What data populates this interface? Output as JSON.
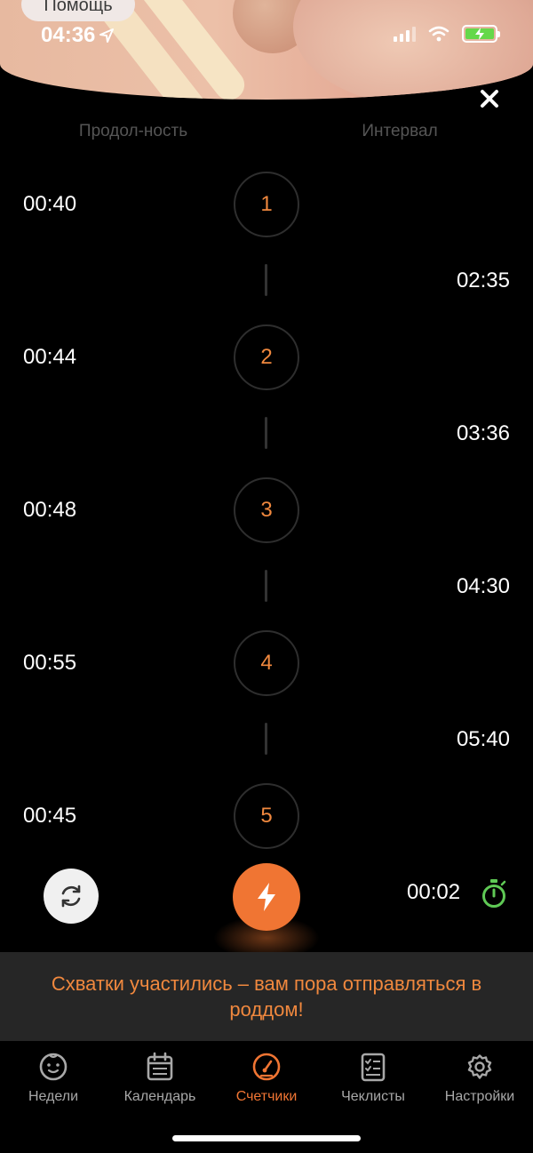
{
  "status_bar": {
    "help_label": "Помощь",
    "time": "04:36"
  },
  "header": {
    "col_duration": "Продол-ность",
    "col_interval": "Интервал"
  },
  "contractions": [
    {
      "number": "1",
      "duration": "00:40"
    },
    {
      "number": "2",
      "duration": "00:44"
    },
    {
      "number": "3",
      "duration": "00:48"
    },
    {
      "number": "4",
      "duration": "00:55"
    },
    {
      "number": "5",
      "duration": "00:45"
    }
  ],
  "intervals": [
    "02:35",
    "03:36",
    "04:30",
    "05:40"
  ],
  "controls": {
    "timer": "00:02"
  },
  "alert": {
    "message": "Схватки участились – вам пора отправляться в роддом!"
  },
  "tabbar": {
    "items": [
      {
        "label": "Недели",
        "icon": "baby-face-icon"
      },
      {
        "label": "Календарь",
        "icon": "calendar-icon"
      },
      {
        "label": "Счетчики",
        "icon": "gauge-icon",
        "active": true
      },
      {
        "label": "Чеклисты",
        "icon": "checklist-icon"
      },
      {
        "label": "Настройки",
        "icon": "gear-icon"
      }
    ]
  },
  "colors": {
    "accent": "#f07533",
    "number": "#f0883e",
    "stopwatch": "#5fc955",
    "alert_bg": "#262626"
  }
}
